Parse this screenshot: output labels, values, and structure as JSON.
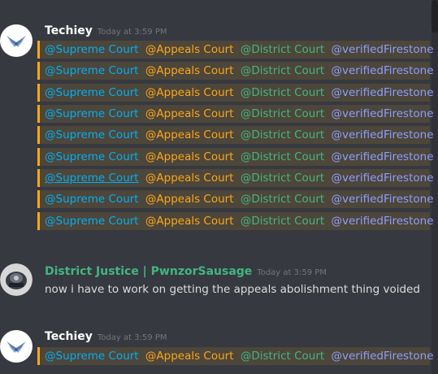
{
  "colors": {
    "background": "#36393f",
    "mention_highlight_bar": "#faa81a",
    "supreme_role": "#00aff4",
    "appeals_role": "#faa61a",
    "district_role": "#43b581",
    "verified_role": "#8c9eff",
    "techiey_name": "#ffffff",
    "district_justice_name": "#43b581"
  },
  "messages": [
    {
      "author": "Techiey",
      "timestamp": "Today at 3:59 PM",
      "lines": [
        [
          "@Supreme Court",
          "@Appeals Court",
          "@District Court",
          "@verifiedFirestone"
        ],
        [
          "@Supreme Court",
          "@Appeals Court",
          "@District Court",
          "@verifiedFirestone"
        ],
        [
          "@Supreme Court",
          "@Appeals Court",
          "@District Court",
          "@verifiedFirestone"
        ],
        [
          "@Supreme Court",
          "@Appeals Court",
          "@District Court",
          "@verifiedFirestone"
        ],
        [
          "@Supreme Court",
          "@Appeals Court",
          "@District Court",
          "@verifiedFirestone"
        ],
        [
          "@Supreme Court",
          "@Appeals Court",
          "@District Court",
          "@verifiedFirestone"
        ],
        [
          "@Supreme Court",
          "@Appeals Court",
          "@District Court",
          "@verifiedFirestone"
        ],
        [
          "@Supreme Court",
          "@Appeals Court",
          "@District Court",
          "@verifiedFirestone"
        ],
        [
          "@Supreme Court",
          "@Appeals Court",
          "@District Court",
          "@verifiedFirestone"
        ]
      ]
    },
    {
      "author": "District Justice | PwnzorSausage",
      "timestamp": "Today at 3:59 PM",
      "text": "now i have to work on getting the appeals abolishment thing voided"
    },
    {
      "author": "Techiey",
      "timestamp": "Today at 3:59 PM",
      "lines": [
        [
          "@Supreme Court",
          "@Appeals Court",
          "@District Court",
          "@verifiedFirestone"
        ]
      ]
    }
  ]
}
